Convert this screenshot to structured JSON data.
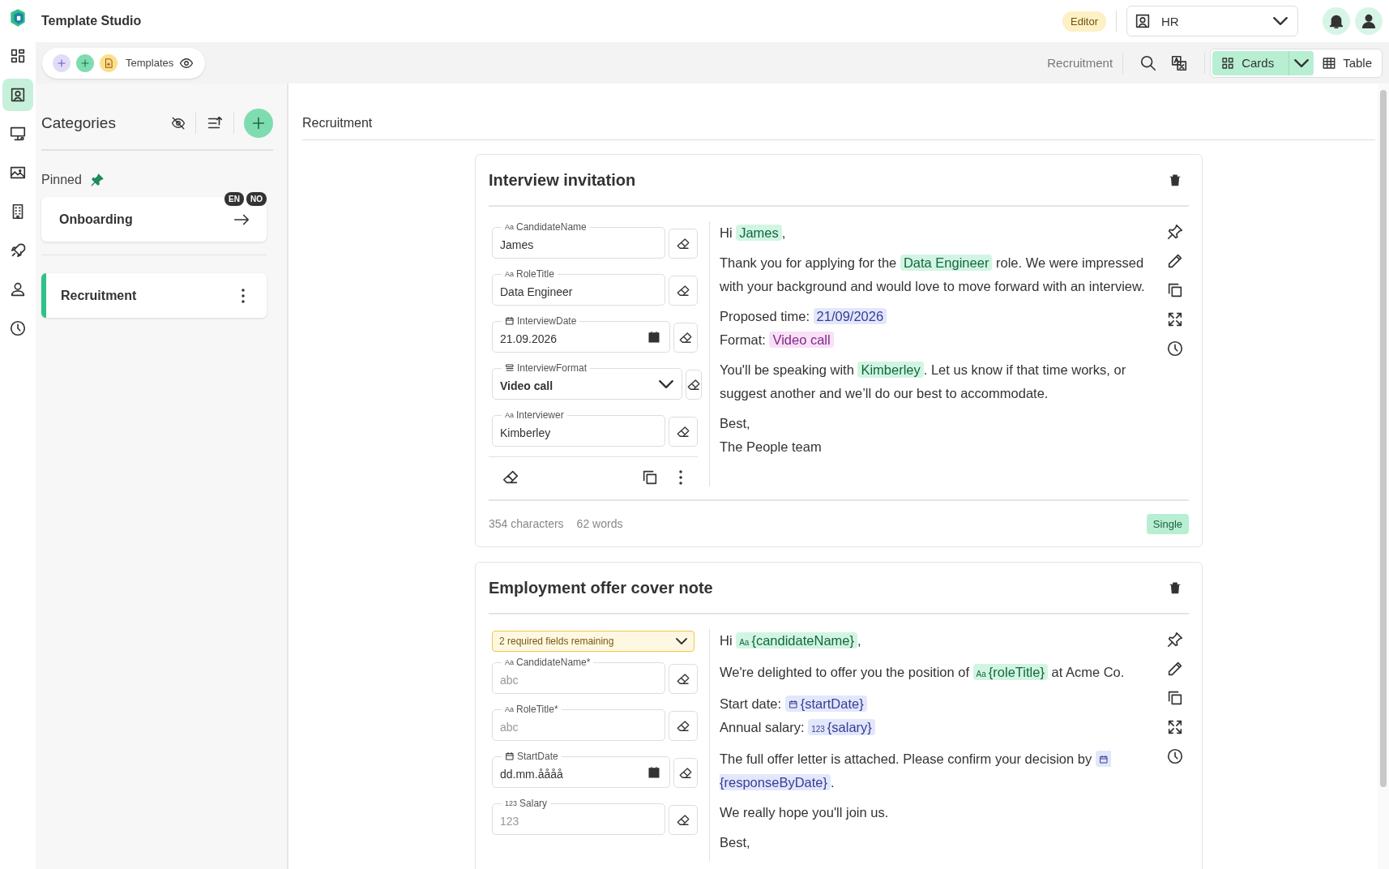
{
  "app": {
    "title": "Template Studio",
    "role_badge": "Editor",
    "workspace": "HR"
  },
  "rail": [
    {
      "selected": false
    },
    {
      "selected": true
    },
    {
      "selected": false
    },
    {
      "selected": false
    },
    {
      "selected": false
    },
    {
      "selected": false
    },
    {
      "selected": false
    },
    {
      "selected": false
    }
  ],
  "toolbar": {
    "label": "Templates",
    "breadcrumb": "Recruitment",
    "views": [
      {
        "label": "Cards",
        "selected": true
      },
      {
        "label": "Table",
        "selected": false
      }
    ]
  },
  "sidebar": {
    "title": "Categories",
    "pinned_label": "Pinned",
    "pinned": [
      {
        "name": "Onboarding",
        "languages": [
          "EN",
          "NO"
        ],
        "selected": false
      }
    ],
    "categories": [
      {
        "name": "Recruitment",
        "selected": true
      }
    ]
  },
  "main": {
    "heading": "Recruitment",
    "templates": [
      {
        "title": "Interview invitation",
        "fields": [
          {
            "kind": "text",
            "prefix": "Aa",
            "label": "CandidateName",
            "value": "James"
          },
          {
            "kind": "text",
            "prefix": "Aa",
            "label": "RoleTitle",
            "value": "Data Engineer"
          },
          {
            "kind": "date",
            "label": "InterviewDate",
            "value": "21.09.2026"
          },
          {
            "kind": "select",
            "label": "InterviewFormat",
            "value": "Video call"
          },
          {
            "kind": "text",
            "prefix": "Aa",
            "label": "Interviewer",
            "value": "Kimberley"
          }
        ],
        "body": [
          [
            [
              {
                "t": "Hi "
              },
              {
                "chip": "James",
                "kind": "text"
              },
              {
                "t": ","
              }
            ]
          ],
          [
            [
              {
                "t": "Thank you for applying for the "
              },
              {
                "chip": "Data Engineer",
                "kind": "text"
              },
              {
                "t": " role. We were impressed with your background and would love to move forward with an interview."
              }
            ]
          ],
          [
            [
              {
                "t": "Proposed time: "
              },
              {
                "chip": "21/09/2026",
                "kind": "date",
                "show_icon": false
              }
            ],
            [
              {
                "t": "Format: "
              },
              {
                "chip": "Video call",
                "kind": "select"
              }
            ]
          ],
          [
            [
              {
                "t": "You'll be speaking with "
              },
              {
                "chip": "Kimberley",
                "kind": "text"
              },
              {
                "t": ". Let us know if that time works, or suggest another and we’ll do our best to accommodate."
              }
            ]
          ],
          [
            [
              {
                "t": "Best,"
              }
            ],
            [
              {
                "t": "The People team"
              }
            ]
          ]
        ],
        "footer": {
          "characters": "354 characters",
          "words": "62 words",
          "mode": "Single"
        }
      },
      {
        "title": "Employment offer cover note",
        "requirement": "2 required fields remaining",
        "fields": [
          {
            "kind": "text",
            "prefix": "Aa",
            "label": "CandidateName*",
            "placeholder": "abc"
          },
          {
            "kind": "text",
            "prefix": "Aa",
            "label": "RoleTitle*",
            "placeholder": "abc"
          },
          {
            "kind": "date",
            "label": "StartDate",
            "placeholder": "dd.mm.åååå"
          },
          {
            "kind": "number",
            "prefix": "123",
            "label": "Salary",
            "placeholder": "123"
          }
        ],
        "body": [
          [
            [
              {
                "t": "Hi "
              },
              {
                "chip": "{candidateName}",
                "kind": "text",
                "prefix": "Aa"
              },
              {
                "t": ","
              }
            ]
          ],
          [
            [
              {
                "t": "We're delighted to offer you the position of "
              },
              {
                "chip": "{roleTitle}",
                "kind": "text",
                "prefix": "Aa"
              },
              {
                "t": " at Acme Co."
              }
            ]
          ],
          [
            [
              {
                "t": "Start date: "
              },
              {
                "chip": "{startDate}",
                "kind": "date",
                "show_icon": true
              }
            ],
            [
              {
                "t": "Annual salary: "
              },
              {
                "chip": "{salary}",
                "kind": "number",
                "prefix": "123"
              }
            ]
          ],
          [
            [
              {
                "t": "The full offer letter is attached. Please confirm your decision by "
              },
              {
                "chip": "{responseByDate}",
                "kind": "date",
                "show_icon": true
              },
              {
                "t": "."
              }
            ]
          ],
          [
            [
              {
                "t": "We really hope you'll join us."
              }
            ]
          ],
          [
            [
              {
                "t": "Best,"
              }
            ]
          ]
        ]
      }
    ]
  }
}
